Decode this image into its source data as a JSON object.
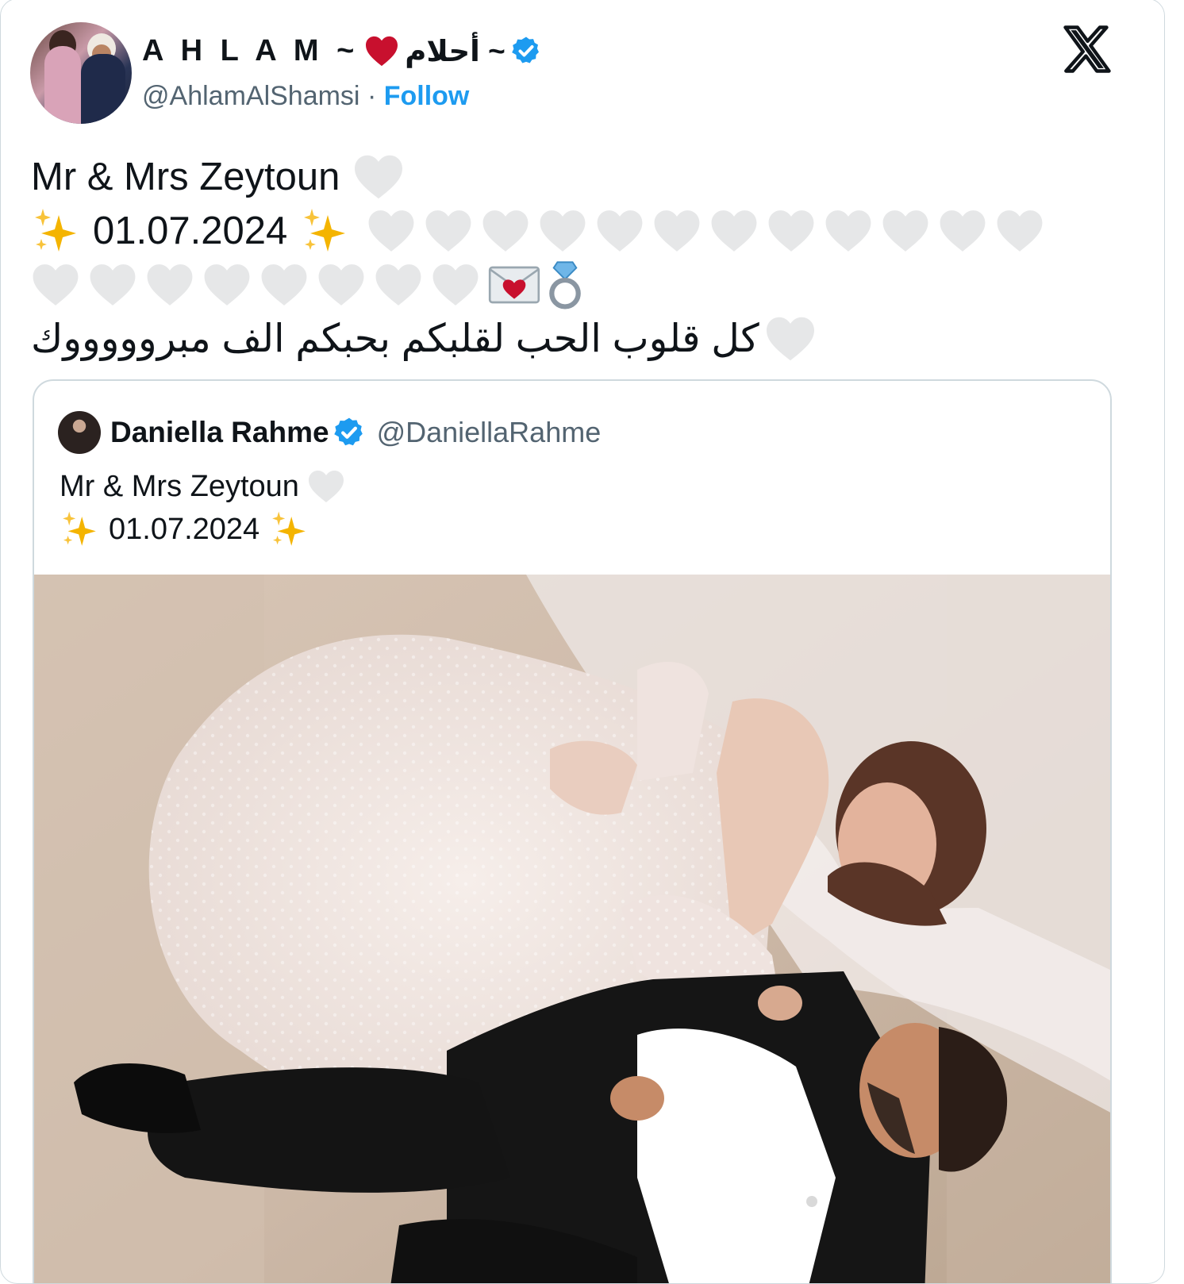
{
  "author": {
    "display_name_latin": "A H L A M ~",
    "display_name_arabic": "~ أحلام",
    "handle": "@AhlamAlShamsi",
    "separator": " · ",
    "follow_label": "Follow"
  },
  "tweet": {
    "line1": "Mr & Mrs Zeytoun",
    "line2_date": "01.07.2024",
    "line4_arabic": "كل قلوب الحب لقلبكم بحبكم الف مبروووووك",
    "hearts_row_a": [
      1,
      2,
      3,
      4,
      5,
      6,
      7,
      8,
      9,
      10,
      11,
      12
    ],
    "hearts_row_b": [
      1,
      2,
      3,
      4,
      5,
      6,
      7,
      8
    ],
    "emoji_envelope": "💌",
    "emoji_ring": "💍"
  },
  "quoted": {
    "display_name": "Daniella Rahme",
    "handle": "@DaniellaRahme",
    "line1": "Mr & Mrs Zeytoun",
    "line2_date": "01.07.2024"
  },
  "icons": {
    "platform": "x-logo-icon",
    "verified": "verified-badge-icon",
    "heart": "red-heart-icon",
    "white_heart": "white-heart-icon",
    "sparkles": "sparkles-icon"
  },
  "colors": {
    "link_blue": "#1d9bf0",
    "verified_blue": "#1d9bf0",
    "secondary_text": "#536471",
    "heart_red": "#c8102e",
    "border": "#cfd9de"
  }
}
